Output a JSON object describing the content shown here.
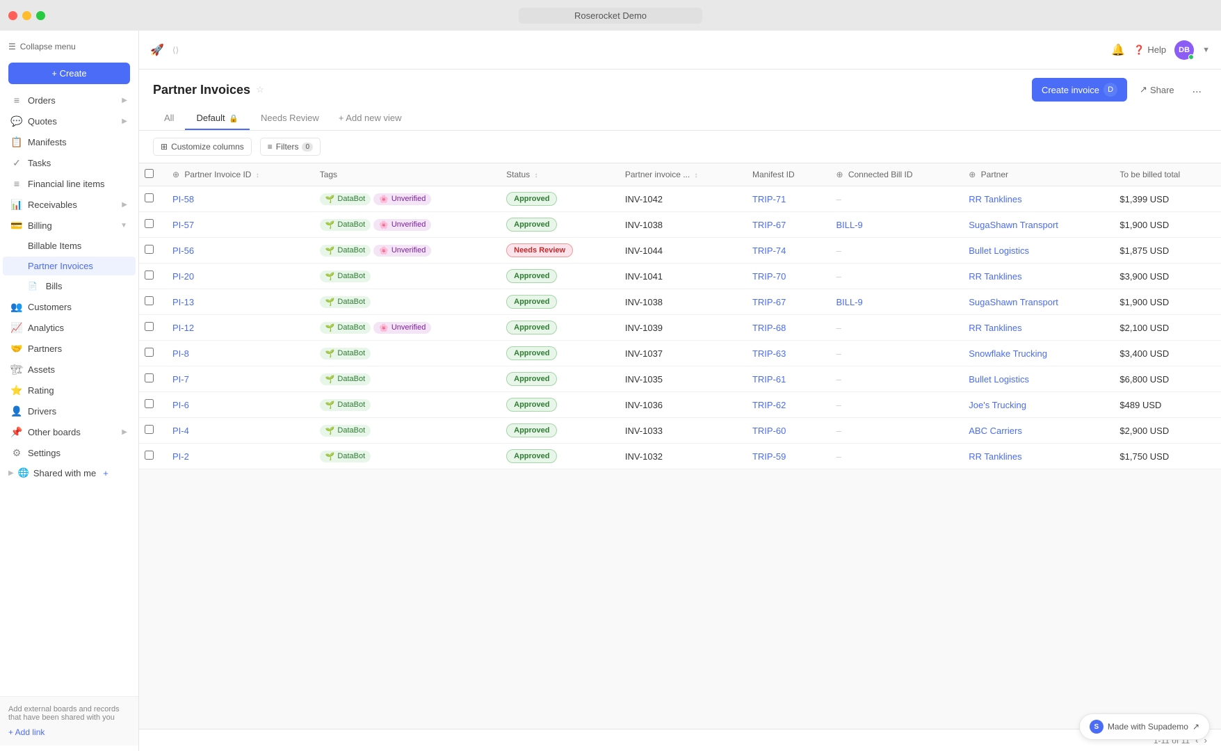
{
  "titleBar": {
    "title": "Roserocket Demo"
  },
  "sidebar": {
    "collapseLabel": "Collapse menu",
    "createLabel": "+ Create",
    "items": [
      {
        "id": "orders",
        "label": "Orders",
        "icon": "≡",
        "hasArrow": true
      },
      {
        "id": "quotes",
        "label": "Quotes",
        "icon": "💬",
        "hasArrow": true
      },
      {
        "id": "manifests",
        "label": "Manifests",
        "icon": "📋"
      },
      {
        "id": "tasks",
        "label": "Tasks",
        "icon": "✓"
      },
      {
        "id": "financial-line-items",
        "label": "Financial line items",
        "icon": "≡"
      },
      {
        "id": "receivables",
        "label": "Receivables",
        "icon": "📊",
        "hasArrow": true
      },
      {
        "id": "billing",
        "label": "Billing",
        "icon": "💳",
        "hasArrow": true,
        "active": false
      },
      {
        "id": "billable-items",
        "label": "Billable Items",
        "sub": true
      },
      {
        "id": "partner-invoices",
        "label": "Partner Invoices",
        "sub": true,
        "active": true
      },
      {
        "id": "bills",
        "label": "Bills",
        "sub": true,
        "hasBill": true
      },
      {
        "id": "customers",
        "label": "Customers",
        "icon": "👥"
      },
      {
        "id": "analytics",
        "label": "Analytics",
        "icon": "📈"
      },
      {
        "id": "partners",
        "label": "Partners",
        "icon": "🤝"
      },
      {
        "id": "assets",
        "label": "Assets",
        "icon": "🏗"
      },
      {
        "id": "rating",
        "label": "Rating",
        "icon": "⭐"
      },
      {
        "id": "drivers",
        "label": "Drivers",
        "icon": "👤"
      },
      {
        "id": "other-boards",
        "label": "Other boards",
        "icon": "📌",
        "hasArrow": true
      },
      {
        "id": "settings",
        "label": "Settings",
        "icon": "⚙"
      },
      {
        "id": "shared-with-me",
        "label": "Shared with me",
        "icon": "🌐",
        "hasPlusIcon": true
      }
    ],
    "sharedFooter": {
      "description": "Add external boards and records that have been shared with you",
      "addLinkLabel": "+ Add link"
    }
  },
  "topbar": {
    "bellIcon": "🔔",
    "helpLabel": "Help",
    "avatarInitials": "DB",
    "avatarBg": "#8b5cf6"
  },
  "pageHeader": {
    "title": "Partner Invoices",
    "tabs": [
      {
        "id": "all",
        "label": "All"
      },
      {
        "id": "default",
        "label": "Default",
        "active": true,
        "hasLock": true
      },
      {
        "id": "needs-review",
        "label": "Needs Review"
      },
      {
        "id": "add-new",
        "label": "+ Add new view"
      }
    ],
    "createInvoiceLabel": "Create invoice",
    "shareLabel": "Share",
    "moreIcon": "..."
  },
  "toolbar": {
    "customizeColumnsLabel": "Customize columns",
    "filtersLabel": "Filters",
    "filterCount": "0"
  },
  "table": {
    "columns": [
      {
        "id": "partner-invoice-id",
        "label": "Partner Invoice ID",
        "hasIcon": true,
        "sortable": true
      },
      {
        "id": "tags",
        "label": "Tags"
      },
      {
        "id": "status",
        "label": "Status",
        "sortable": true
      },
      {
        "id": "partner-invoice-num",
        "label": "Partner invoice ...",
        "sortable": true
      },
      {
        "id": "manifest-id",
        "label": "Manifest ID"
      },
      {
        "id": "connected-bill-id",
        "label": "Connected Bill ID",
        "hasIcon": true
      },
      {
        "id": "partner",
        "label": "Partner",
        "hasIcon": true
      },
      {
        "id": "to-be-billed-total",
        "label": "To be billed total"
      }
    ],
    "rows": [
      {
        "id": "PI-58",
        "tags": [
          "DataBot",
          "Unverified"
        ],
        "status": "Approved",
        "partnerInvoiceNum": "INV-1042",
        "manifestId": "TRIP-71",
        "connectedBillId": "--",
        "partner": "RR Tanklines",
        "toBeBilledTotal": "$1,399 USD"
      },
      {
        "id": "PI-57",
        "tags": [
          "DataBot",
          "Unverified"
        ],
        "status": "Approved",
        "partnerInvoiceNum": "INV-1038",
        "manifestId": "TRIP-67",
        "connectedBillId": "BILL-9",
        "partner": "SugaShawn Transport",
        "toBeBilledTotal": "$1,900 USD"
      },
      {
        "id": "PI-56",
        "tags": [
          "DataBot",
          "Unverified"
        ],
        "status": "Needs Review",
        "partnerInvoiceNum": "INV-1044",
        "manifestId": "TRIP-74",
        "connectedBillId": "--",
        "partner": "Bullet Logistics",
        "toBeBilledTotal": "$1,875 USD"
      },
      {
        "id": "PI-20",
        "tags": [
          "DataBot"
        ],
        "status": "Approved",
        "partnerInvoiceNum": "INV-1041",
        "manifestId": "TRIP-70",
        "connectedBillId": "--",
        "partner": "RR Tanklines",
        "toBeBilledTotal": "$3,900 USD"
      },
      {
        "id": "PI-13",
        "tags": [
          "DataBot"
        ],
        "status": "Approved",
        "partnerInvoiceNum": "INV-1038",
        "manifestId": "TRIP-67",
        "connectedBillId": "BILL-9",
        "partner": "SugaShawn Transport",
        "toBeBilledTotal": "$1,900 USD"
      },
      {
        "id": "PI-12",
        "tags": [
          "DataBot",
          "Unverified"
        ],
        "status": "Approved",
        "partnerInvoiceNum": "INV-1039",
        "manifestId": "TRIP-68",
        "connectedBillId": "--",
        "partner": "RR Tanklines",
        "toBeBilledTotal": "$2,100 USD"
      },
      {
        "id": "PI-8",
        "tags": [
          "DataBot"
        ],
        "status": "Approved",
        "partnerInvoiceNum": "INV-1037",
        "manifestId": "TRIP-63",
        "connectedBillId": "--",
        "partner": "Snowflake Trucking",
        "toBeBilledTotal": "$3,400 USD"
      },
      {
        "id": "PI-7",
        "tags": [
          "DataBot"
        ],
        "status": "Approved",
        "partnerInvoiceNum": "INV-1035",
        "manifestId": "TRIP-61",
        "connectedBillId": "--",
        "partner": "Bullet Logistics",
        "toBeBilledTotal": "$6,800 USD"
      },
      {
        "id": "PI-6",
        "tags": [
          "DataBot"
        ],
        "status": "Approved",
        "partnerInvoiceNum": "INV-1036",
        "manifestId": "TRIP-62",
        "connectedBillId": "--",
        "partner": "Joe's Trucking",
        "toBeBilledTotal": "$489 USD"
      },
      {
        "id": "PI-4",
        "tags": [
          "DataBot"
        ],
        "status": "Approved",
        "partnerInvoiceNum": "INV-1033",
        "manifestId": "TRIP-60",
        "connectedBillId": "--",
        "partner": "ABC Carriers",
        "toBeBilledTotal": "$2,900 USD"
      },
      {
        "id": "PI-2",
        "tags": [
          "DataBot"
        ],
        "status": "Approved",
        "partnerInvoiceNum": "INV-1032",
        "manifestId": "TRIP-59",
        "connectedBillId": "--",
        "partner": "RR Tanklines",
        "toBeBilledTotal": "$1,750 USD"
      }
    ]
  },
  "footer": {
    "paginationInfo": "1-11 of 11",
    "prevIcon": "‹",
    "nextIcon": "›"
  },
  "supademo": {
    "label": "Made with Supademo",
    "arrowIcon": "↗"
  }
}
